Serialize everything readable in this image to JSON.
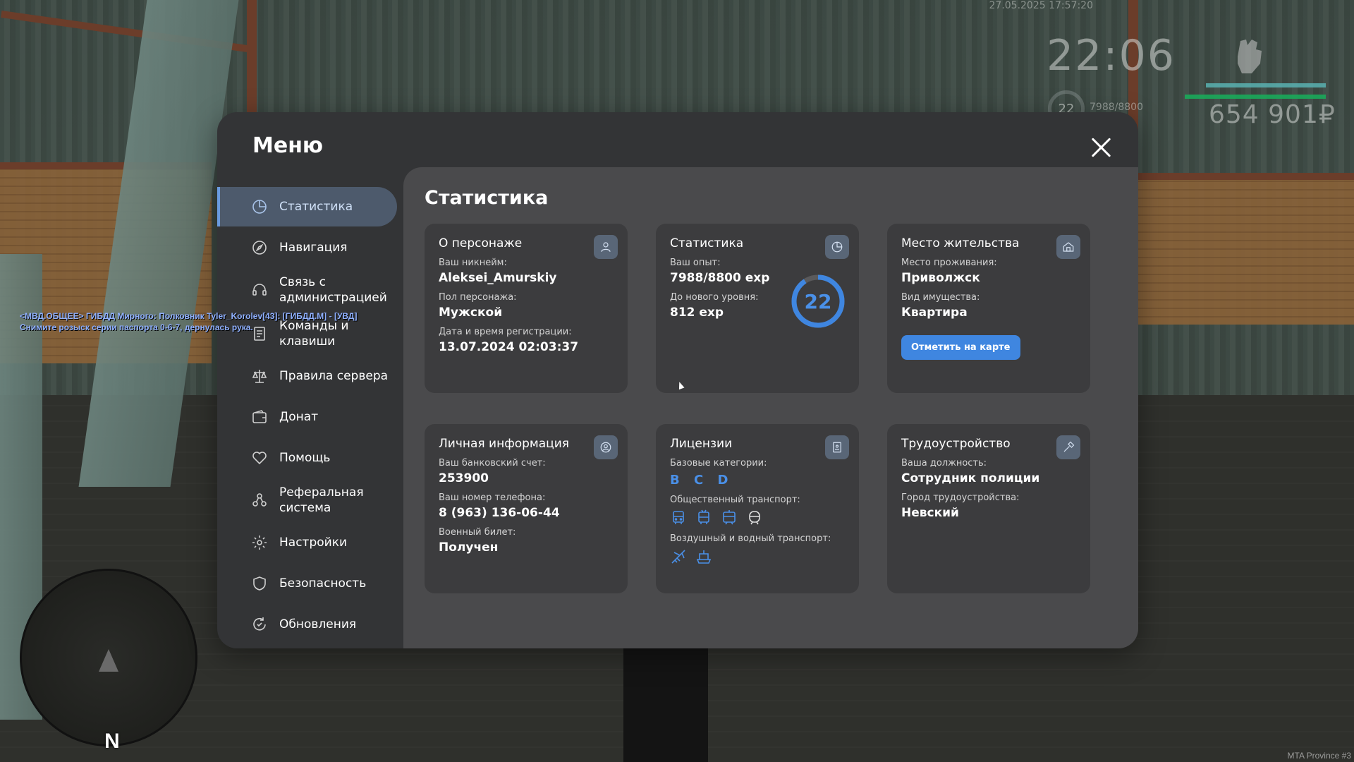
{
  "hud": {
    "datetime": "27.05.2025 17:57:20",
    "time": "22:06",
    "level": "22",
    "exp": "7988/8800",
    "money": "654 901₽"
  },
  "chat": {
    "line1": "<МВД.ОБЩЕЕ> ГИБДД Мирного: Полковник Tyler_Korolev[43]: [ГИБДД.М] - [УВД]",
    "line2": "Снимите розыск серии паспорта 0-6-7, дернулась рука."
  },
  "minimap": {
    "compass": "N"
  },
  "server": "MTA Province #3",
  "menu": {
    "title": "Меню",
    "sidebar": [
      {
        "label": "Статистика",
        "icon": "pie-chart-icon",
        "active": true
      },
      {
        "label": "Навигация",
        "icon": "compass-icon"
      },
      {
        "label": "Связь с администрацией",
        "icon": "headset-icon"
      },
      {
        "label": "Команды и клавиши",
        "icon": "document-icon"
      },
      {
        "label": "Правила сервера",
        "icon": "scales-icon"
      },
      {
        "label": "Донат",
        "icon": "wallet-icon"
      },
      {
        "label": "Помощь",
        "icon": "heart-hand-icon"
      },
      {
        "label": "Реферальная система",
        "icon": "network-icon"
      },
      {
        "label": "Настройки",
        "icon": "gear-icon"
      },
      {
        "label": "Безопасность",
        "icon": "shield-icon"
      },
      {
        "label": "Обновления",
        "icon": "refresh-icon"
      }
    ],
    "content_title": "Статистика",
    "cards": {
      "character": {
        "title": "О персонаже",
        "nickname_label": "Ваш никнейм:",
        "nickname": "Aleksei_Amurskiy",
        "gender_label": "Пол персонажа:",
        "gender": "Мужской",
        "reg_label": "Дата и время регистрации:",
        "reg": "13.07.2024 02:03:37"
      },
      "stats": {
        "title": "Статистика",
        "exp_label": "Ваш опыт:",
        "exp": "7988/8800 exp",
        "next_label": "До нового уровня:",
        "next": "812 exp",
        "level": "22",
        "progress": 0.9077
      },
      "residence": {
        "title": "Место жительства",
        "place_label": "Место проживания:",
        "place": "Приволжск",
        "type_label": "Вид имущества:",
        "type": "Квартира",
        "button": "Отметить на карте"
      },
      "personal": {
        "title": "Личная информация",
        "bank_label": "Ваш банковский счет:",
        "bank": "253900",
        "phone_label": "Ваш номер телефона:",
        "phone": "8 (963) 136-06-44",
        "military_label": "Военный билет:",
        "military": "Получен"
      },
      "licenses": {
        "title": "Лицензии",
        "base_label": "Базовые категории:",
        "categories": [
          "B",
          "C",
          "D"
        ],
        "public_label": "Общественный транспорт:",
        "air_label": "Воздушный и водный транспорт:"
      },
      "employment": {
        "title": "Трудоустройство",
        "position_label": "Ваша должность:",
        "position": "Сотрудник полиции",
        "city_label": "Город трудоустройства:",
        "city": "Невский"
      }
    }
  }
}
